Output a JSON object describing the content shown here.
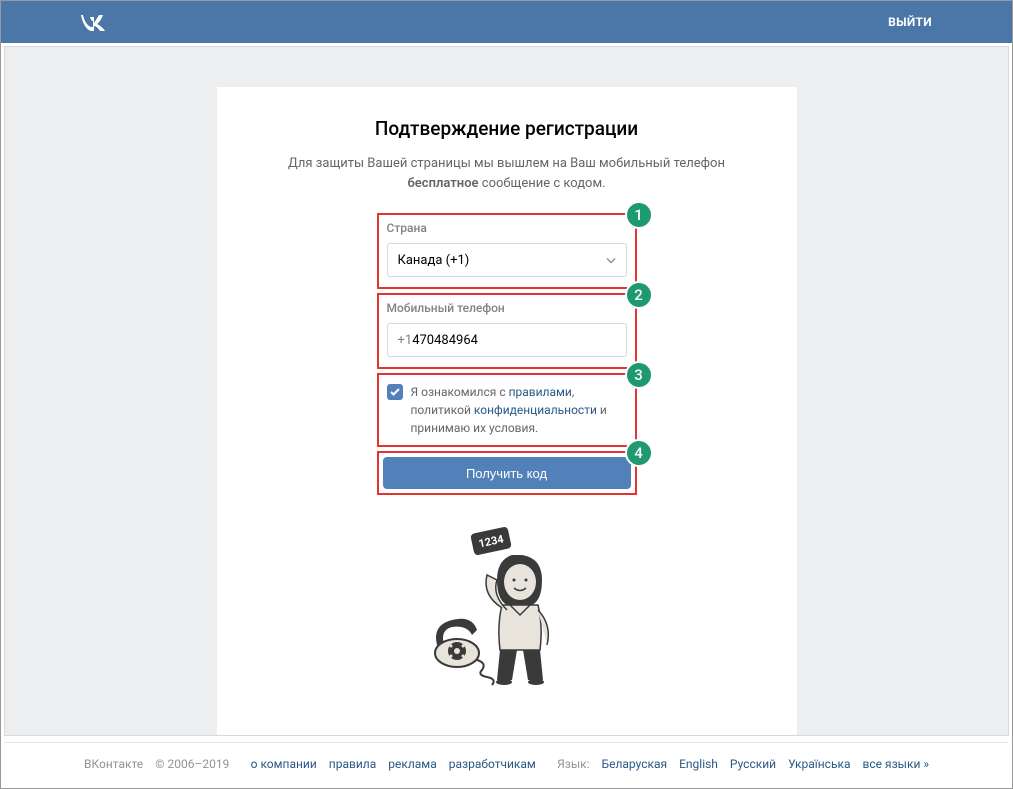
{
  "header": {
    "logout_label": "ВЫЙТИ"
  },
  "card": {
    "title": "Подтверждение регистрации",
    "subtitle_part1": "Для защиты Вашей страницы мы вышлем на Ваш мобильный телефон ",
    "subtitle_bold": "бесплатное",
    "subtitle_part2": " сообщение с кодом."
  },
  "form": {
    "country_label": "Страна",
    "country_value": "Канада (+1)",
    "phone_label": "Мобильный телефон",
    "phone_prefix": "+1",
    "phone_value": "470484964",
    "terms_part1": "Я ознакомился с ",
    "terms_link1": "правилами",
    "terms_part2": ", политикой ",
    "terms_link2": "конфиденциальности",
    "terms_part3": " и принимаю их условия.",
    "submit_label": "Получить код"
  },
  "annotations": {
    "step1": "1",
    "step2": "2",
    "step3": "3",
    "step4": "4"
  },
  "illustration": {
    "bubble_text": "1234"
  },
  "footer": {
    "brand": "ВКонтакте",
    "copyright": "© 2006–2019",
    "links": {
      "about": "о компании",
      "rules": "правила",
      "ads": "реклама",
      "devs": "разработчикам"
    },
    "lang_label": "Язык:",
    "langs": {
      "by": "Беларуская",
      "en": "English",
      "ru": "Русский",
      "ua": "Українська",
      "all": "все языки »"
    }
  }
}
